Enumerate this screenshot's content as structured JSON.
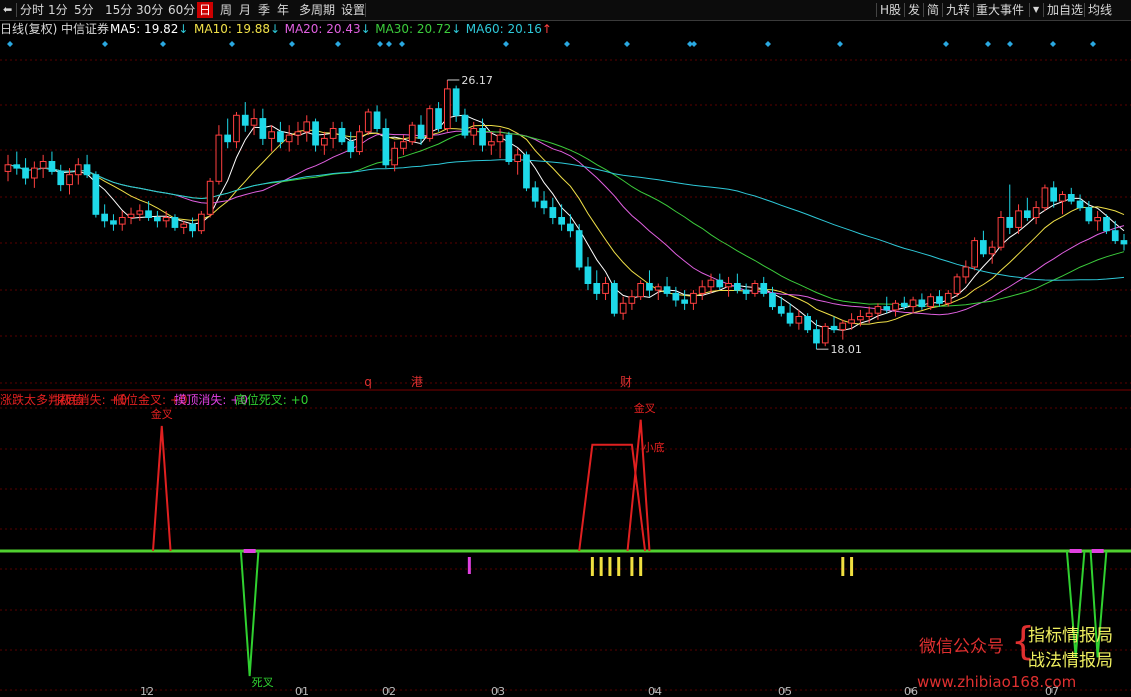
{
  "toolbar": {
    "back_icon": "back-arrow-icon",
    "periods": [
      "分时",
      "1分",
      "5分",
      "15分",
      "30分",
      "60分",
      "日",
      "周",
      "月",
      "季",
      "年",
      "多周期",
      "设置"
    ],
    "active_period": "日",
    "right": [
      "H股",
      "发",
      "简",
      "九转",
      "重大事件",
      "加自选",
      "均线"
    ],
    "dropdown_icon": "triangle-down-icon"
  },
  "legend": {
    "chart_name": "日线(复权)",
    "stock_name": "中信证券",
    "ma": [
      {
        "text": "MA5: 19.82",
        "arrow": "↓",
        "color": "#ffffff"
      },
      {
        "text": "MA10: 19.88",
        "arrow": "↓",
        "color": "#f0e048"
      },
      {
        "text": "MA20: 20.43",
        "arrow": "↓",
        "color": "#e060e0"
      },
      {
        "text": "MA30: 20.72",
        "arrow": "↓",
        "color": "#3ccc3c"
      },
      {
        "text": "MA60: 20.16",
        "arrow": "↑",
        "color": "#2ec8d8"
      }
    ]
  },
  "indicator_legend": [
    {
      "text": "涨跌太多判极值",
      "color": "#e02020"
    },
    {
      "text": "探底消失: +0",
      "color": "#e02020"
    },
    {
      "text": "低位金叉: +0",
      "color": "#e02020"
    },
    {
      "text": "摸顶消失: +0",
      "color": "#e040e0"
    },
    {
      "text": "高位死叉: +0",
      "color": "#30d030"
    }
  ],
  "watermark": {
    "line1": "微信公众号",
    "brand1": "指标情报局",
    "brand2": "战法情报局",
    "site": "www.zhibiao168.com",
    "line1_color": "#e03030",
    "brand_color": "#f0f060"
  },
  "chart_data": [
    {
      "type": "candlestick",
      "title": "日线(复权) 中信证券",
      "x_tick_labels": [
        "12",
        "01",
        "02",
        "03",
        "04",
        "05",
        "06",
        "07"
      ],
      "annotations": [
        {
          "text": "26.17",
          "kind": "high"
        },
        {
          "text": "18.01",
          "kind": "low"
        },
        {
          "text": "q",
          "kind": "event",
          "color": "#e03030"
        },
        {
          "text": "港",
          "kind": "event",
          "color": "#e03030"
        },
        {
          "text": "财",
          "kind": "event",
          "color": "#e03030"
        }
      ],
      "ohlc": [
        [
          23.4,
          23.9,
          23.1,
          23.6
        ],
        [
          23.6,
          24.0,
          23.3,
          23.5
        ],
        [
          23.5,
          23.8,
          23.0,
          23.2
        ],
        [
          23.2,
          23.7,
          22.9,
          23.5
        ],
        [
          23.5,
          23.9,
          23.2,
          23.7
        ],
        [
          23.7,
          24.0,
          23.3,
          23.4
        ],
        [
          23.4,
          23.6,
          22.8,
          23.0
        ],
        [
          23.0,
          23.5,
          22.7,
          23.3
        ],
        [
          23.3,
          23.8,
          23.0,
          23.6
        ],
        [
          23.6,
          23.9,
          23.2,
          23.3
        ],
        [
          23.3,
          23.4,
          22.0,
          22.1
        ],
        [
          22.1,
          22.4,
          21.7,
          21.9
        ],
        [
          21.9,
          22.1,
          21.6,
          21.8
        ],
        [
          21.8,
          22.2,
          21.6,
          22.0
        ],
        [
          22.0,
          22.3,
          21.8,
          22.1
        ],
        [
          22.1,
          22.4,
          21.9,
          22.2
        ],
        [
          22.2,
          22.5,
          21.9,
          22.0
        ],
        [
          22.0,
          22.2,
          21.7,
          21.9
        ],
        [
          21.9,
          22.2,
          21.7,
          22.0
        ],
        [
          22.0,
          22.1,
          21.6,
          21.7
        ],
        [
          21.7,
          21.9,
          21.5,
          21.8
        ],
        [
          21.8,
          22.0,
          21.4,
          21.6
        ],
        [
          21.6,
          22.2,
          21.5,
          22.1
        ],
        [
          22.1,
          23.2,
          22.0,
          23.1
        ],
        [
          23.1,
          24.8,
          23.0,
          24.5
        ],
        [
          24.5,
          25.0,
          24.1,
          24.3
        ],
        [
          24.3,
          25.2,
          24.1,
          25.1
        ],
        [
          25.1,
          25.5,
          24.6,
          24.8
        ],
        [
          24.8,
          25.3,
          24.5,
          25.0
        ],
        [
          25.0,
          25.3,
          24.2,
          24.4
        ],
        [
          24.4,
          24.8,
          24.0,
          24.6
        ],
        [
          24.6,
          24.9,
          24.1,
          24.3
        ],
        [
          24.3,
          24.8,
          24.0,
          24.5
        ],
        [
          24.5,
          24.9,
          24.2,
          24.6
        ],
        [
          24.6,
          25.1,
          24.3,
          24.9
        ],
        [
          24.9,
          25.0,
          24.0,
          24.2
        ],
        [
          24.2,
          24.6,
          23.9,
          24.4
        ],
        [
          24.4,
          24.9,
          24.1,
          24.7
        ],
        [
          24.7,
          24.9,
          24.2,
          24.3
        ],
        [
          24.3,
          24.6,
          23.8,
          24.0
        ],
        [
          24.0,
          24.8,
          23.9,
          24.6
        ],
        [
          24.6,
          25.3,
          24.5,
          25.2
        ],
        [
          25.2,
          25.4,
          24.6,
          24.7
        ],
        [
          24.7,
          25.0,
          23.5,
          23.6
        ],
        [
          23.6,
          24.3,
          23.4,
          24.1
        ],
        [
          24.1,
          24.5,
          23.9,
          24.3
        ],
        [
          24.3,
          24.9,
          24.2,
          24.8
        ],
        [
          24.8,
          25.1,
          24.2,
          24.4
        ],
        [
          24.4,
          25.4,
          24.3,
          25.3
        ],
        [
          25.3,
          25.5,
          24.6,
          24.7
        ],
        [
          24.7,
          26.17,
          24.6,
          25.9
        ],
        [
          25.9,
          26.0,
          24.9,
          25.1
        ],
        [
          25.1,
          25.3,
          24.4,
          24.5
        ],
        [
          24.5,
          24.9,
          24.2,
          24.7
        ],
        [
          24.7,
          25.0,
          24.0,
          24.2
        ],
        [
          24.2,
          24.6,
          23.9,
          24.3
        ],
        [
          24.3,
          24.7,
          23.8,
          24.5
        ],
        [
          24.5,
          24.6,
          23.6,
          23.7
        ],
        [
          23.7,
          24.1,
          23.3,
          23.9
        ],
        [
          23.9,
          24.0,
          22.8,
          22.9
        ],
        [
          22.9,
          23.1,
          22.3,
          22.5
        ],
        [
          22.5,
          22.8,
          22.1,
          22.3
        ],
        [
          22.3,
          22.6,
          21.8,
          22.0
        ],
        [
          22.0,
          22.4,
          21.6,
          21.8
        ],
        [
          21.8,
          22.1,
          21.4,
          21.6
        ],
        [
          21.6,
          21.8,
          20.4,
          20.5
        ],
        [
          20.5,
          20.8,
          19.8,
          20.0
        ],
        [
          20.0,
          20.4,
          19.5,
          19.7
        ],
        [
          19.7,
          20.2,
          19.5,
          20.0
        ],
        [
          20.0,
          20.1,
          19.0,
          19.1
        ],
        [
          19.1,
          19.6,
          18.9,
          19.4
        ],
        [
          19.4,
          19.8,
          19.2,
          19.6
        ],
        [
          19.6,
          20.1,
          19.5,
          20.0
        ],
        [
          20.0,
          20.4,
          19.6,
          19.8
        ],
        [
          19.8,
          20.0,
          19.5,
          19.9
        ],
        [
          19.9,
          20.2,
          19.6,
          19.7
        ],
        [
          19.7,
          19.9,
          19.3,
          19.5
        ],
        [
          19.5,
          19.8,
          19.2,
          19.4
        ],
        [
          19.4,
          19.8,
          19.2,
          19.7
        ],
        [
          19.7,
          20.1,
          19.5,
          19.9
        ],
        [
          19.9,
          20.3,
          19.7,
          20.1
        ],
        [
          20.1,
          20.3,
          19.8,
          19.9
        ],
        [
          19.9,
          20.2,
          19.6,
          20.0
        ],
        [
          20.0,
          20.3,
          19.7,
          19.8
        ],
        [
          19.8,
          20.0,
          19.5,
          19.7
        ],
        [
          19.7,
          20.1,
          19.6,
          20.0
        ],
        [
          20.0,
          20.2,
          19.6,
          19.7
        ],
        [
          19.7,
          19.9,
          19.2,
          19.3
        ],
        [
          19.3,
          19.6,
          19.0,
          19.1
        ],
        [
          19.1,
          19.4,
          18.7,
          18.8
        ],
        [
          18.8,
          19.2,
          18.6,
          19.0
        ],
        [
          19.0,
          19.1,
          18.5,
          18.6
        ],
        [
          18.6,
          18.9,
          18.01,
          18.2
        ],
        [
          18.2,
          18.8,
          18.1,
          18.7
        ],
        [
          18.7,
          19.0,
          18.5,
          18.6
        ],
        [
          18.6,
          18.9,
          18.3,
          18.8
        ],
        [
          18.8,
          19.1,
          18.6,
          18.9
        ],
        [
          18.9,
          19.2,
          18.7,
          19.0
        ],
        [
          19.0,
          19.3,
          18.8,
          19.1
        ],
        [
          19.1,
          19.4,
          18.9,
          19.3
        ],
        [
          19.3,
          19.6,
          19.1,
          19.2
        ],
        [
          19.2,
          19.5,
          19.0,
          19.4
        ],
        [
          19.4,
          19.6,
          19.2,
          19.3
        ],
        [
          19.3,
          19.6,
          19.1,
          19.5
        ],
        [
          19.5,
          19.7,
          19.2,
          19.3
        ],
        [
          19.3,
          19.7,
          19.2,
          19.6
        ],
        [
          19.6,
          19.8,
          19.3,
          19.4
        ],
        [
          19.4,
          19.8,
          19.3,
          19.7
        ],
        [
          19.7,
          20.3,
          19.6,
          20.2
        ],
        [
          20.2,
          20.7,
          20.0,
          20.5
        ],
        [
          20.5,
          21.4,
          20.4,
          21.3
        ],
        [
          21.3,
          21.6,
          20.8,
          20.9
        ],
        [
          20.9,
          21.3,
          20.6,
          21.1
        ],
        [
          21.1,
          22.2,
          21.0,
          22.0
        ],
        [
          22.0,
          23.0,
          21.5,
          21.7
        ],
        [
          21.7,
          22.4,
          21.5,
          22.2
        ],
        [
          22.2,
          22.6,
          21.9,
          22.0
        ],
        [
          22.0,
          22.5,
          21.8,
          22.3
        ],
        [
          22.3,
          23.0,
          22.2,
          22.9
        ],
        [
          22.9,
          23.1,
          22.3,
          22.5
        ],
        [
          22.5,
          22.8,
          22.1,
          22.7
        ],
        [
          22.7,
          22.9,
          22.4,
          22.5
        ],
        [
          22.5,
          22.7,
          22.2,
          22.3
        ],
        [
          22.3,
          22.5,
          21.8,
          21.9
        ],
        [
          21.9,
          22.2,
          21.6,
          22.0
        ],
        [
          22.0,
          22.1,
          21.5,
          21.6
        ],
        [
          21.6,
          21.9,
          21.2,
          21.3
        ],
        [
          21.3,
          21.5,
          21.0,
          21.2
        ]
      ],
      "series": [
        {
          "name": "MA5",
          "color": "#ffffff"
        },
        {
          "name": "MA10",
          "color": "#f0e048"
        },
        {
          "name": "MA20",
          "color": "#e060e0"
        },
        {
          "name": "MA30",
          "color": "#3ccc3c"
        },
        {
          "name": "MA60",
          "color": "#2ec8d8"
        }
      ],
      "ylim": [
        17.5,
        27.2
      ],
      "up_color": "#ff4040",
      "down_color": "#1ed8e8",
      "grid": "horizontal dashed"
    },
    {
      "type": "line",
      "title": "涨跌太多判极值",
      "baseline_color": "#50d030",
      "annotations": [
        {
          "text": "金叉",
          "kind": "peak",
          "color": "#e02020"
        },
        {
          "text": "金叉",
          "kind": "peak",
          "color": "#e02020"
        },
        {
          "text": "小底",
          "kind": "peak",
          "color": "#e02020"
        },
        {
          "text": "死叉",
          "kind": "trough",
          "color": "#30d030"
        }
      ],
      "spikes_up": [
        {
          "start": 16.5,
          "peak": 17.5,
          "end": 18.5,
          "level": 1.0
        }
      ],
      "plateaus_up": [
        {
          "rise_start": 65.0,
          "rise_end": 66.5,
          "fall_start": 71.0,
          "fall_end": 72.5,
          "level": 0.85
        }
      ],
      "spikes_up2": [
        {
          "start": 70.5,
          "peak": 72.0,
          "end": 73.0,
          "level": 1.05
        }
      ],
      "spikes_down": [
        {
          "start": 26.5,
          "trough": 27.5,
          "end": 28.5,
          "level": -1.0
        },
        {
          "start": 120.5,
          "trough": 121.5,
          "end": 122.5,
          "level": -0.85
        },
        {
          "start": 123.2,
          "trough": 124.0,
          "end": 125.0,
          "level": -0.85
        },
        {
          "start": 131.0,
          "trough": 132.0,
          "end": 133.0,
          "level": -0.85
        }
      ],
      "markers_yellow": [
        66.5,
        67.5,
        68.5,
        69.5,
        71.0,
        72.0,
        95.0,
        96.0
      ],
      "markers_magenta": [
        52.5
      ],
      "magenta_bars": [
        27.5,
        121.5,
        124.0,
        132.0
      ]
    }
  ]
}
